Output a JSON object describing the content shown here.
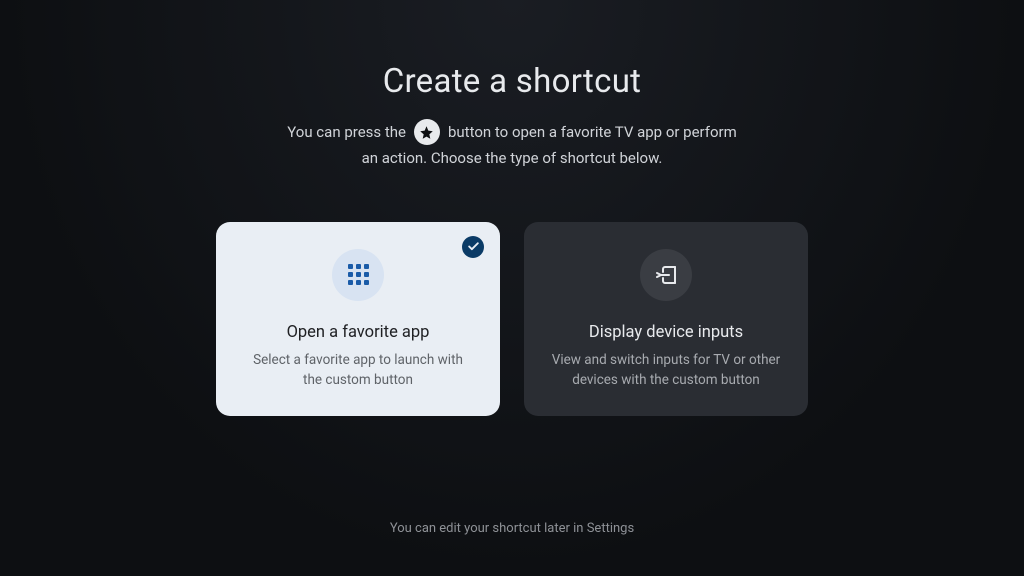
{
  "header": {
    "title": "Create a shortcut",
    "subtitle_part1": "You can press the",
    "subtitle_part2": "button to open a favorite TV app or perform",
    "subtitle_line2": "an action. Choose the type of shortcut below."
  },
  "cards": {
    "favorite": {
      "title": "Open a favorite app",
      "description": "Select a favorite app to launch with the custom button"
    },
    "inputs": {
      "title": "Display device inputs",
      "description": "View and switch inputs for TV or other devices with the custom button"
    }
  },
  "footer": {
    "text": "You can edit your shortcut later in Settings"
  }
}
